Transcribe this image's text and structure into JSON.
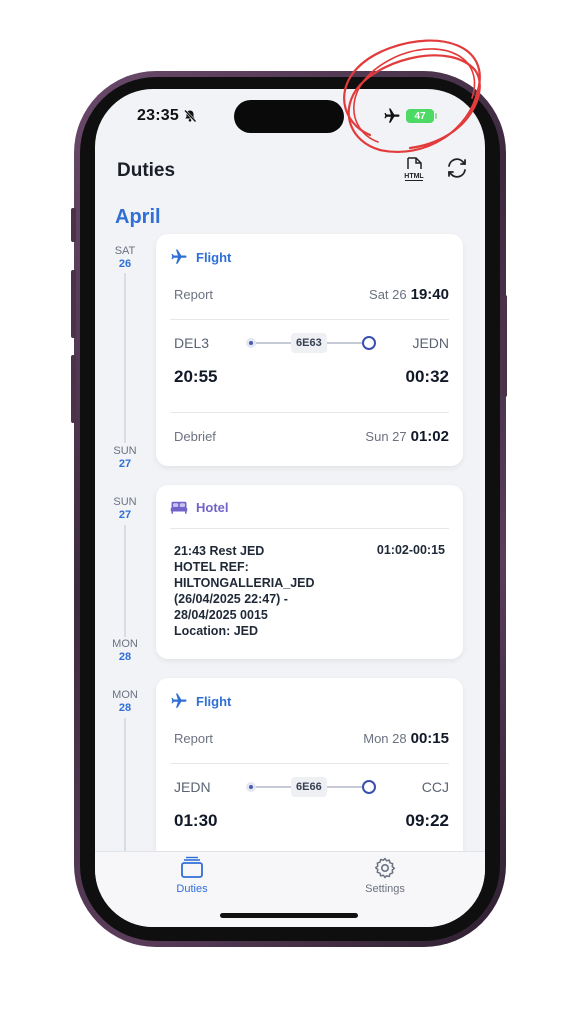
{
  "status_bar": {
    "time": "23:35",
    "battery": "47"
  },
  "header": {
    "title": "Duties",
    "export_label": "HTML"
  },
  "month": "April",
  "timeline": [
    {
      "weekday": "SAT",
      "day": "26"
    },
    {
      "weekday": "SUN",
      "day": "27"
    },
    {
      "weekday": "SUN",
      "day": "27"
    },
    {
      "weekday": "MON",
      "day": "28"
    },
    {
      "weekday": "MON",
      "day": "28"
    }
  ],
  "duties": [
    {
      "type": "Flight",
      "report_label": "Report",
      "report_day": "Sat 26",
      "report_time": "19:40",
      "from_code": "DEL3",
      "to_code": "JEDN",
      "flight_no": "6E63",
      "dep_time": "20:55",
      "arr_time": "00:32",
      "debrief_label": "Debrief",
      "debrief_day": "Sun 27",
      "debrief_time": "01:02"
    },
    {
      "type": "Hotel",
      "lines": [
        "21:43 Rest JED",
        "HOTEL REF:",
        "HILTONGALLERIA_JED",
        "(26/04/2025 22:47) -",
        "28/04/2025 0015",
        "Location: JED"
      ],
      "time_range": "01:02-00:15"
    },
    {
      "type": "Flight",
      "report_label": "Report",
      "report_day": "Mon 28",
      "report_time": "00:15",
      "from_code": "JEDN",
      "to_code": "CCJ",
      "flight_no": "6E66",
      "dep_time": "01:30",
      "arr_time": "09:22"
    }
  ],
  "tabs": [
    {
      "label": "Duties",
      "active": true
    },
    {
      "label": "Settings",
      "active": false
    }
  ],
  "colors": {
    "accent": "#2f6fd6",
    "hotel": "#7163c9",
    "annotation": "#e23b3b"
  }
}
